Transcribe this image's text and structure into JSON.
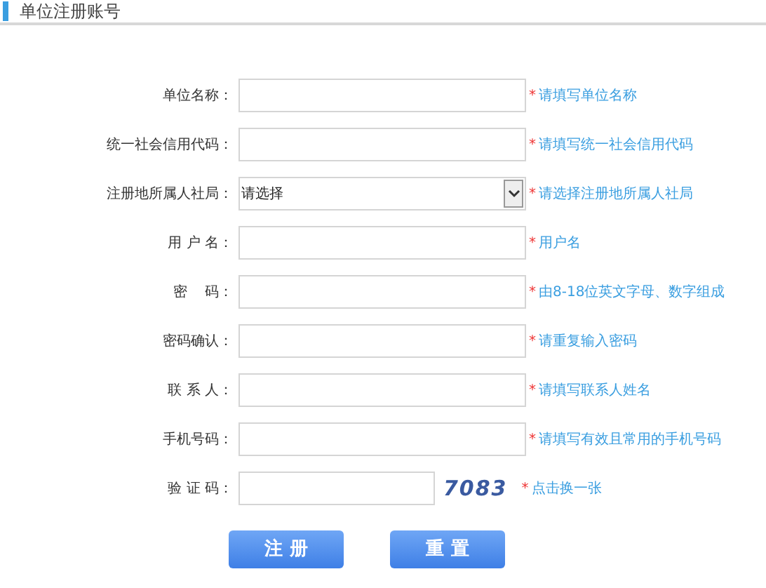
{
  "header": {
    "title": "单位注册账号"
  },
  "fields": [
    {
      "kind": "text",
      "label": "单位名称：",
      "mark": "*",
      "hint": "请填写单位名称"
    },
    {
      "kind": "text",
      "label": "统一社会信用代码：",
      "mark": "*",
      "hint": "请填写统一社会信用代码"
    },
    {
      "kind": "select",
      "label": "注册地所属人社局：",
      "value": "请选择",
      "mark": "*",
      "hint": "请选择注册地所属人社局"
    },
    {
      "kind": "text",
      "label": "用 户 名：",
      "mark": "*",
      "hint": "用户名"
    },
    {
      "kind": "text",
      "label": "密    码：",
      "mark": "*",
      "hint": "由8-18位英文字母、数字组成"
    },
    {
      "kind": "text",
      "label": "密码确认：",
      "mark": "*",
      "hint": "请重复输入密码"
    },
    {
      "kind": "text",
      "label": "联 系 人：",
      "mark": "*",
      "hint": "请填写联系人姓名"
    },
    {
      "kind": "text",
      "label": "手机号码：",
      "mark": "*",
      "hint": "请填写有效且常用的手机号码"
    },
    {
      "kind": "captcha",
      "label": "验 证 码：",
      "code": "7083",
      "mark": "*",
      "hint": "点击换一张"
    }
  ],
  "buttons": [
    "注 册",
    "重 置"
  ]
}
